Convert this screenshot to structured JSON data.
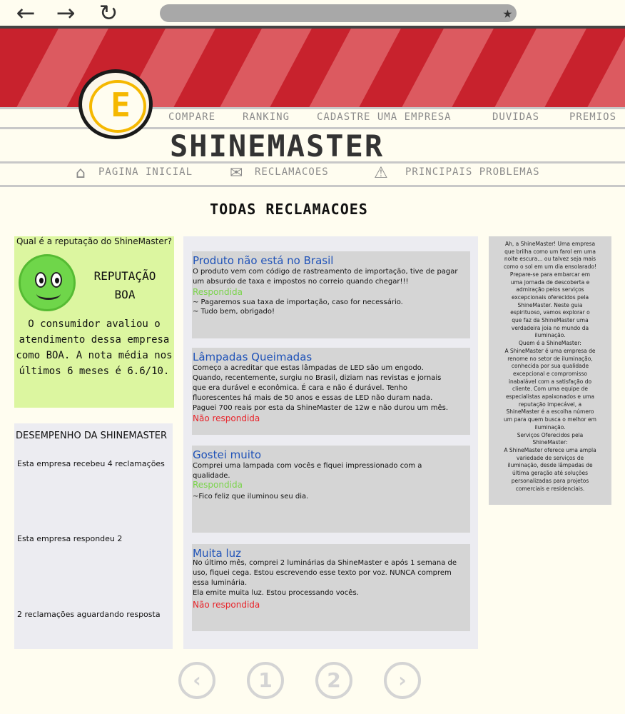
{
  "browser": {
    "back_icon": "arrow-left-icon",
    "forward_icon": "arrow-right-icon",
    "reload_icon": "reload-icon",
    "bookmark_icon": "star-icon"
  },
  "header": {
    "logo_letter": "E",
    "nav": [
      "COMPARE",
      "RANKING",
      "CADASTRE UMA EMPRESA",
      "DUVIDAS",
      "PREMIOS"
    ],
    "title": "SHINEMASTER",
    "subnav": [
      {
        "label": "PAGINA INICIAL",
        "icon": "home-icon"
      },
      {
        "label": "RECLAMACOES",
        "icon": "megaphone-icon"
      },
      {
        "label": "PRINCIPAIS PROBLEMAS",
        "icon": "warning-icon"
      }
    ],
    "brand_color": "#c8222d"
  },
  "page_heading": "TODAS RECLAMACOES",
  "reputation": {
    "question": "Qual é a reputação do ShineMaster?",
    "label_line1": "REPUTAÇÃO",
    "label_line2": "BOA",
    "text": "O consumidor avaliou o atendimento dessa empresa como BOA. A nota média nos últimos 6 meses é 6.6/10."
  },
  "performance": {
    "title": "DESEMPENHO DA SHINEMASTER",
    "received": "Esta empresa recebeu 4 reclamações",
    "answered": "Esta empresa respondeu 2",
    "waiting": "2 reclamações aguardando resposta"
  },
  "complaints": [
    {
      "title": "Produto não está no Brasil",
      "body": "O produto vem com código de rastreamento de importação, tive de pagar um absurdo de taxa e impostos no correio quando chegar!!!",
      "status": "Respondida",
      "reply": "~ Pagaremos sua taxa de importação, caso for necessário.\n~ Tudo bem, obrigado!"
    },
    {
      "title": "Lâmpadas Queimadas",
      "body": "Começo a acreditar que estas lâmpadas de LED são um engodo.\nQuando, recentemente, surgiu no Brasil, diziam nas revistas e jornais\nque era durável e econômica. É cara e não é durável. Tenho\nfluorescentes há mais de 50 anos e essas de LED não duram nada.\nPaguei 700 reais por esta da ShineMaster de 12w e não durou um mês.",
      "status": "Não respondida",
      "reply": ""
    },
    {
      "title": "Gostei muito",
      "body": "Comprei uma lampada com vocês e fiquei impressionado com a\nqualidade.",
      "status": "Respondida",
      "reply": "~Fico feliz que iluminou seu dia."
    },
    {
      "title": "Muita luz",
      "body": "No último mês, comprei 2 luminárias da ShineMaster e após 1 semana de\nuso, fiquei cega. Estou escrevendo esse texto por voz. NUNCA comprem\nessa luminária.\nEla emite muita luz. Estou processando vocês.",
      "status": "Não respondida",
      "reply": ""
    }
  ],
  "status_colors": {
    "answered": "#7ad44a",
    "unanswered": "#e8242a"
  },
  "about": "Ah, a ShineMaster! Uma empresa\nque brilha como um farol em uma\nnoite escura... ou talvez seja mais\ncomo o sol em um dia ensolarado!\nPrepare-se para embarcar em\numa jornada de descoberta e\nadmiração pelos serviços\nexcepcionais oferecidos pela\nShineMaster. Neste guia\nespirituoso, vamos explorar o\nque faz da ShineMaster uma\nverdadeira joia no mundo da\niluminação.\nQuem é a ShineMaster:\nA ShineMaster é uma empresa de\nrenome no setor de iluminação,\nconhecida por sua qualidade\nexcepcional e compromisso\ninabalável com a satisfação do\ncliente. Com uma equipe de\nespecialistas apaixonados e uma\nreputação impecável, a\nShineMaster é a escolha número\num para quem busca o melhor em\niluminação.\nServiços Oferecidos pela\nShineMaster:\nA ShineMaster oferece uma ampla\nvariedade de serviços de\niluminação, desde lâmpadas de\núltima geração até soluções\npersonalizadas para projetos\ncomerciais e residenciais.",
  "pagination": {
    "prev": "‹",
    "pages": [
      "1",
      "2"
    ],
    "next": "›"
  }
}
